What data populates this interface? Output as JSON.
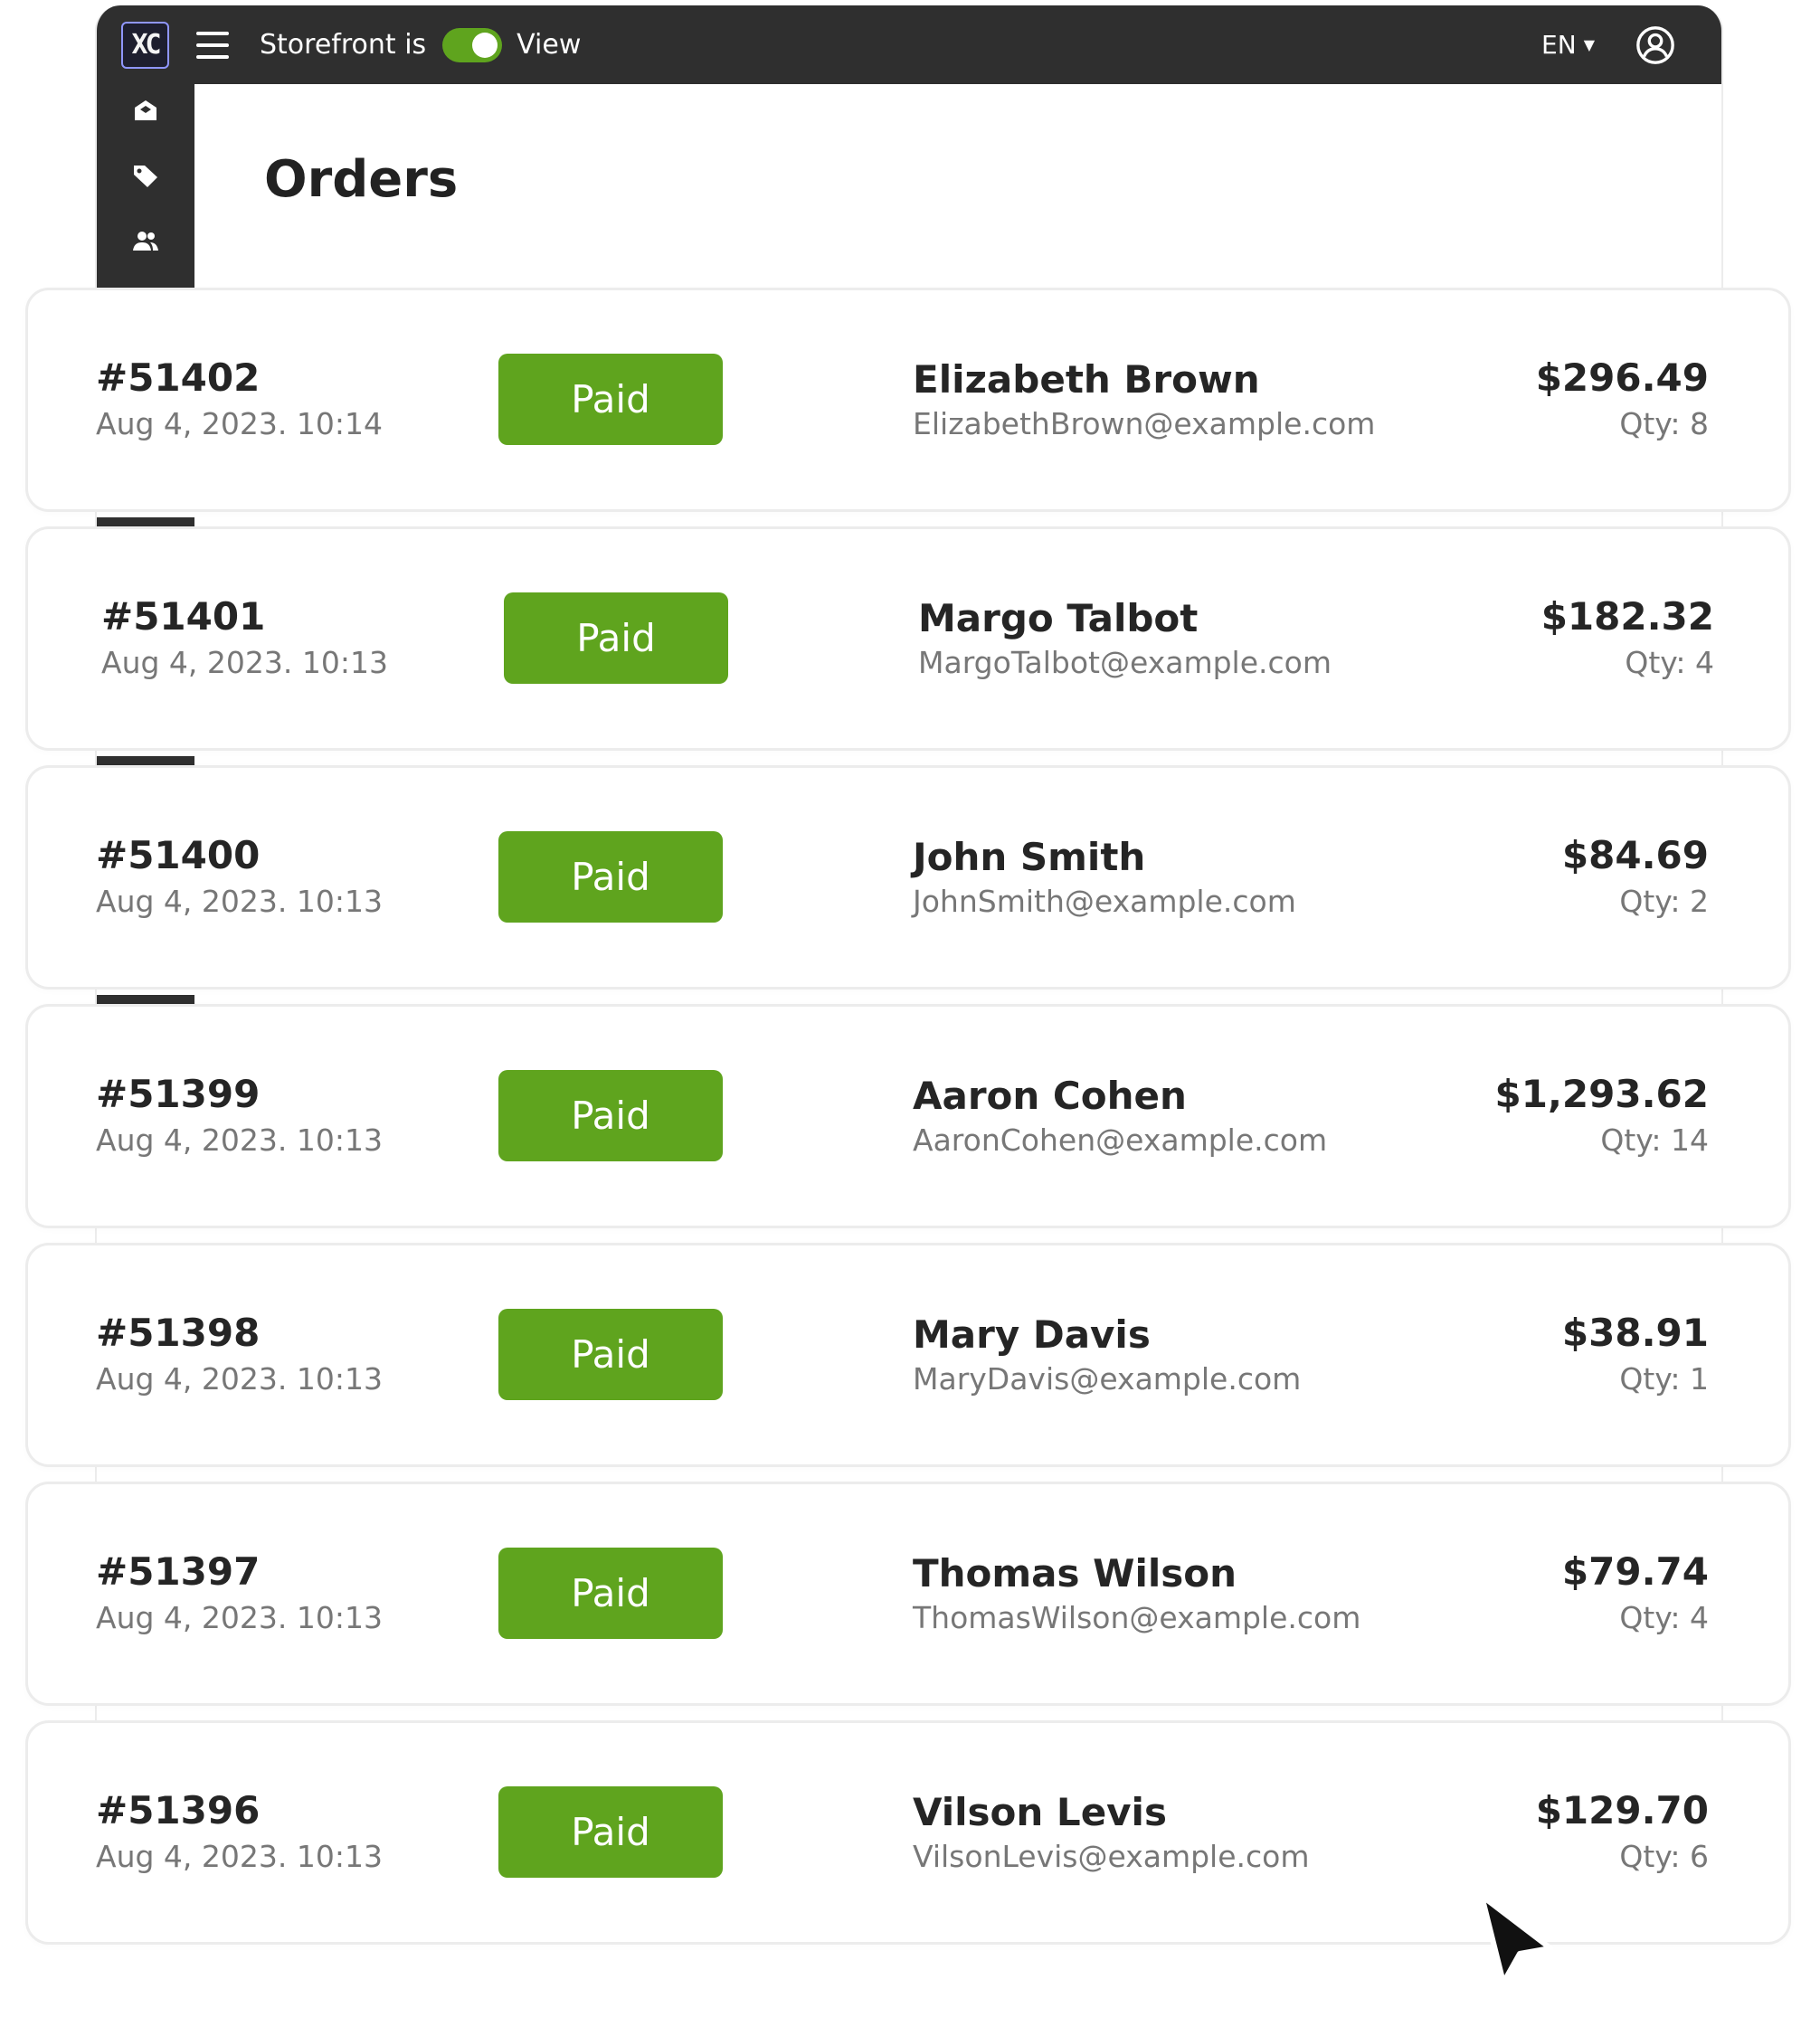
{
  "topbar": {
    "logo_text": "XC",
    "storefront_label": "Storefront is",
    "storefront_enabled": true,
    "view_label": "View",
    "language": "EN"
  },
  "page": {
    "title": "Orders"
  },
  "orders": [
    {
      "id": "#51402",
      "date": "Aug 4, 2023. 10:14",
      "status": "Paid",
      "customer": "Elizabeth Brown",
      "email": "ElizabethBrown@example.com",
      "total": "$296.49",
      "qty": "Qty: 8"
    },
    {
      "id": "#51401",
      "date": "Aug 4, 2023. 10:13",
      "status": "Paid",
      "customer": "Margo Talbot",
      "email": "MargoTalbot@example.com",
      "total": "$182.32",
      "qty": "Qty: 4"
    },
    {
      "id": "#51400",
      "date": "Aug 4, 2023. 10:13",
      "status": "Paid",
      "customer": "John Smith",
      "email": "JohnSmith@example.com",
      "total": "$84.69",
      "qty": "Qty: 2"
    },
    {
      "id": "#51399",
      "date": "Aug 4, 2023. 10:13",
      "status": "Paid",
      "customer": "Aaron Cohen",
      "email": "AaronCohen@example.com",
      "total": "$1,293.62",
      "qty": "Qty: 14"
    },
    {
      "id": "#51398",
      "date": "Aug 4, 2023. 10:13",
      "status": "Paid",
      "customer": "Mary Davis",
      "email": "MaryDavis@example.com",
      "total": "$38.91",
      "qty": "Qty: 1"
    },
    {
      "id": "#51397",
      "date": "Aug 4, 2023. 10:13",
      "status": "Paid",
      "customer": "Thomas Wilson",
      "email": "ThomasWilson@example.com",
      "total": "$79.74",
      "qty": "Qty: 4"
    },
    {
      "id": "#51396",
      "date": "Aug 4, 2023. 10:13",
      "status": "Paid",
      "customer": "Vilson Levis",
      "email": "VilsonLevis@example.com",
      "total": "$129.70",
      "qty": "Qty: 6"
    }
  ],
  "colors": {
    "topbar": "#2f2f2f",
    "paid": "#5fa41e",
    "toggle_on": "#5fa41e"
  },
  "icons": [
    "menu-icon",
    "box-icon",
    "tag-icon",
    "users-icon",
    "chevron-down-icon",
    "account-icon",
    "cursor-icon"
  ]
}
